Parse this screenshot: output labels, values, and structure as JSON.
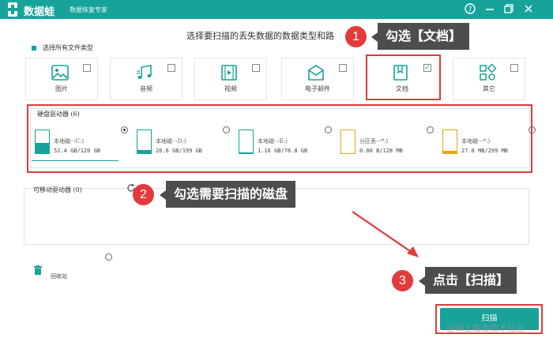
{
  "app": {
    "name": "数据蛙",
    "subtitle": "数据恢复专家"
  },
  "window_controls": [
    "help-icon",
    "minimize-icon",
    "restore-icon",
    "close-icon"
  ],
  "prompt": "选择要扫描的丢失数据的数据类型和路",
  "select_all_label": "选择所有文件类型",
  "file_types": [
    {
      "label": "图片",
      "icon": "image-icon",
      "checked": false
    },
    {
      "label": "音频",
      "icon": "music-icon",
      "checked": false
    },
    {
      "label": "视频",
      "icon": "video-icon",
      "checked": false
    },
    {
      "label": "电子邮件",
      "icon": "mail-icon",
      "checked": false
    },
    {
      "label": "文档",
      "icon": "document-icon",
      "checked": true,
      "check_mark": "✓"
    },
    {
      "label": "其它",
      "icon": "other-icon",
      "checked": false
    }
  ],
  "hard_drives": {
    "title": "硬盘驱动器 (6)",
    "items": [
      {
        "name": "本地磁···C:)",
        "size": "52.4 GB/120 GB",
        "used_fraction": 0.44,
        "color": "#17a39a",
        "selected": true
      },
      {
        "name": "本地磁···D:)",
        "size": "26.6 GB/199 GB",
        "used_fraction": 0.13,
        "color": "#17a39a",
        "selected": false
      },
      {
        "name": "本地磁···E:)",
        "size": "1.16 GB/78.8 GB",
        "used_fraction": 0.02,
        "color": "#17a39a",
        "selected": false
      },
      {
        "name": "分区丢···*:)",
        "size": "0.00  B/128 MB",
        "used_fraction": 0.0,
        "color": "#e8a317",
        "selected": false
      },
      {
        "name": "本地磁···*:)",
        "size": "27.0 MB/299 MB",
        "used_fraction": 0.09,
        "color": "#e8a317",
        "selected": false
      }
    ]
  },
  "removable": {
    "title": "可移动驱动器 (0)"
  },
  "recycle_bin": {
    "label": "回收站"
  },
  "scan_button": "扫描",
  "annotations": [
    {
      "step": "1",
      "text": "勾选【文档】"
    },
    {
      "step": "2",
      "text": "勾选需要扫描的磁盘"
    },
    {
      "step": "3",
      "text": "点击【扫描】"
    }
  ],
  "watermark": "@稀土掘金技术社区",
  "colors": {
    "brand": "#17a39a",
    "annotation_red": "#e23b3b",
    "callout_bg": "#4d4d4d"
  }
}
